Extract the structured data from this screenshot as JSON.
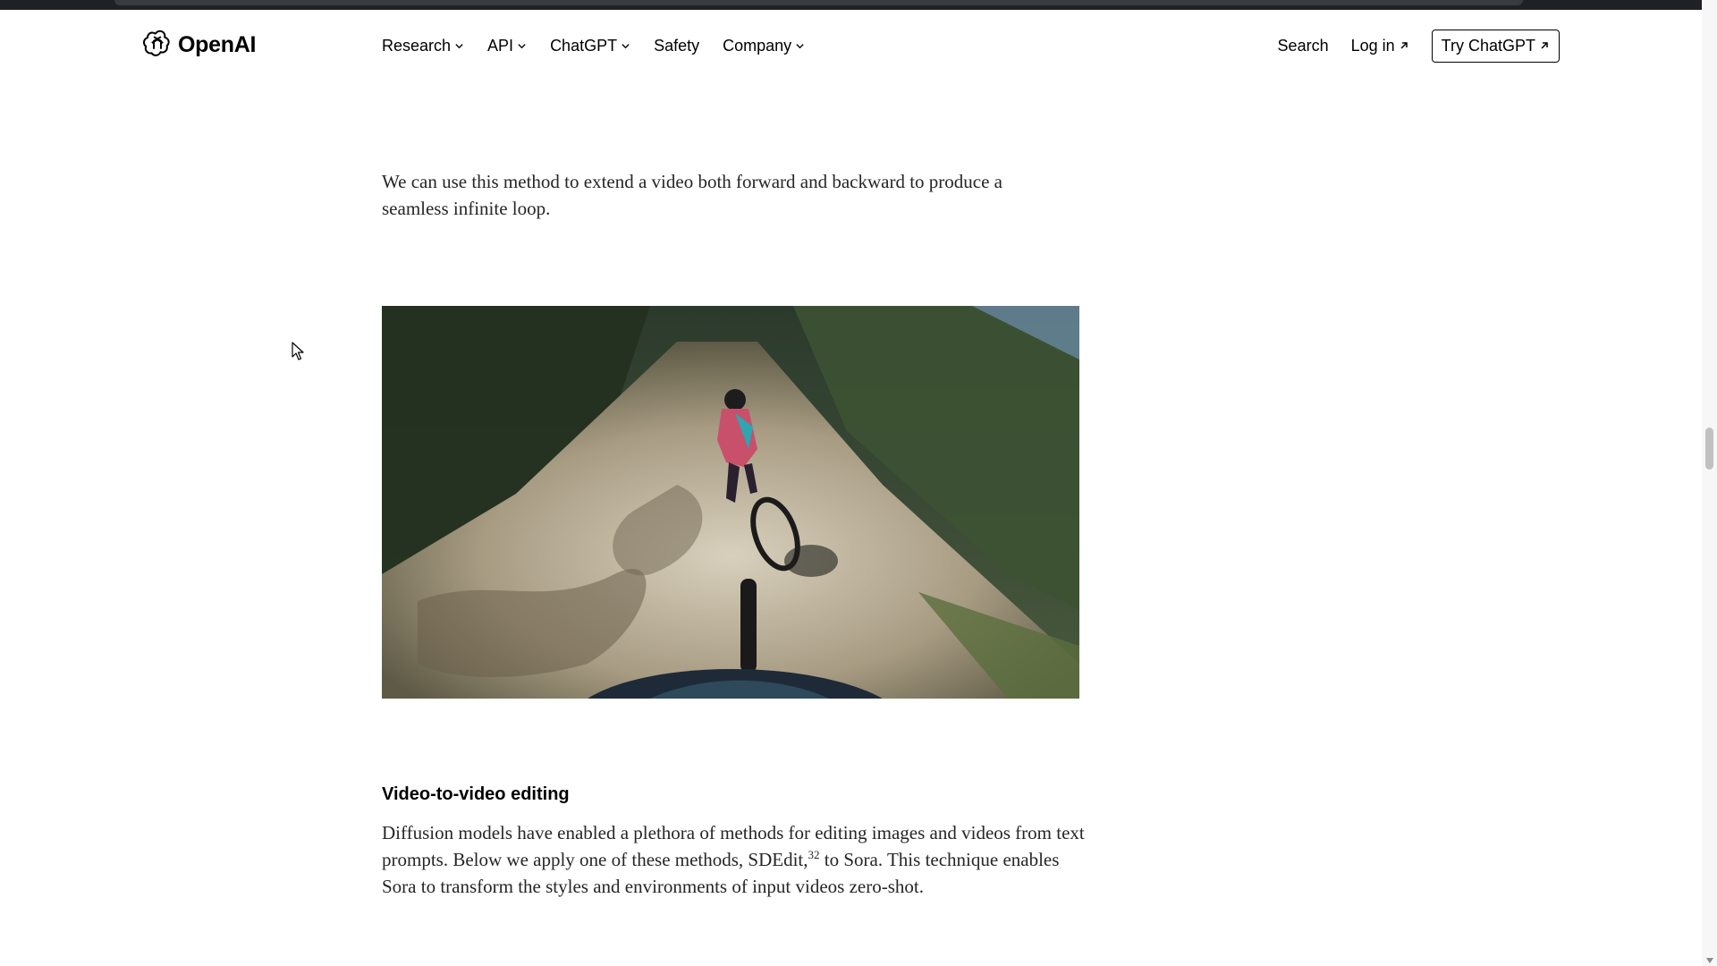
{
  "brand": {
    "name": "OpenAI"
  },
  "nav": {
    "items": [
      {
        "label": "Research",
        "has_dropdown": true
      },
      {
        "label": "API",
        "has_dropdown": true
      },
      {
        "label": "ChatGPT",
        "has_dropdown": true
      },
      {
        "label": "Safety",
        "has_dropdown": false
      },
      {
        "label": "Company",
        "has_dropdown": true
      }
    ],
    "search_label": "Search",
    "login_label": "Log in",
    "cta_label": "Try ChatGPT"
  },
  "article": {
    "paragraph_1": "We can use this method to extend a video both forward and backward to produce a seamless infinite loop.",
    "video": {
      "description_icon": "video-player",
      "content": "mountain-bike-trail-forest"
    },
    "section_heading": "Video-to-video editing",
    "paragraph_2_before": "Diffusion models have enabled a plethora of methods for editing images and videos from text prompts. Below we apply one of these methods, SDEdit,",
    "paragraph_2_ref": "32",
    "paragraph_2_after": " to Sora. This technique enables Sora to transform  the styles and environments of input videos zero-shot."
  },
  "colors": {
    "text": "#262626",
    "browser_bar": "#202124",
    "scroll_thumb": "#c1c1c1"
  }
}
